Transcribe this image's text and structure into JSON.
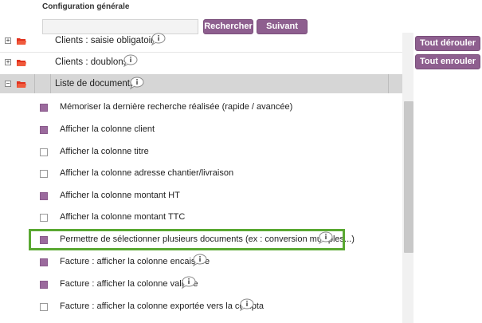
{
  "header": {
    "title": "Configuration générale"
  },
  "toolbar": {
    "search_value": "",
    "search_label": "Rechercher",
    "next_label": "Suivant",
    "expand_all_label": "Tout dérouler",
    "collapse_all_label": "Tout enrouler"
  },
  "tree": {
    "groups": [
      {
        "label": "Clients : saisie obligatoire",
        "expanded": false,
        "has_info": true
      },
      {
        "label": "Clients : doublons",
        "expanded": false,
        "has_info": true
      },
      {
        "label": "Liste de documents",
        "expanded": true,
        "has_info": true,
        "selected": true
      }
    ],
    "items": [
      {
        "label": "Mémoriser la dernière recherche réalisée (rapide / avancée)",
        "checked": true,
        "has_info": false
      },
      {
        "label": "Afficher la colonne client",
        "checked": true,
        "has_info": false
      },
      {
        "label": "Afficher la colonne titre",
        "checked": false,
        "has_info": false
      },
      {
        "label": "Afficher la colonne adresse chantier/livraison",
        "checked": false,
        "has_info": false
      },
      {
        "label": "Afficher la colonne montant HT",
        "checked": true,
        "has_info": false
      },
      {
        "label": "Afficher la colonne montant TTC",
        "checked": false,
        "has_info": false
      },
      {
        "label": "Permettre de sélectionner plusieurs documents (ex : conversion multiples...)",
        "checked": true,
        "has_info": true,
        "highlighted": true
      },
      {
        "label": "Facture : afficher la colonne encaissée",
        "checked": true,
        "has_info": true
      },
      {
        "label": "Facture : afficher la colonne validée",
        "checked": true,
        "has_info": true
      },
      {
        "label": "Facture : afficher la colonne exportée vers la compta",
        "checked": false,
        "has_info": true
      }
    ]
  },
  "colors": {
    "button": "#8e5f8f",
    "checkbox_checked": "#9b6a9d",
    "highlight_border": "#5aa832",
    "selected_row": "#d6d6d6",
    "folder": "#e0321e"
  },
  "icons": {
    "expander_collapsed": "plus-box-icon",
    "expander_expanded": "minus-box-icon",
    "folder": "folder-icon",
    "info": "info-speech-bubble-icon"
  }
}
